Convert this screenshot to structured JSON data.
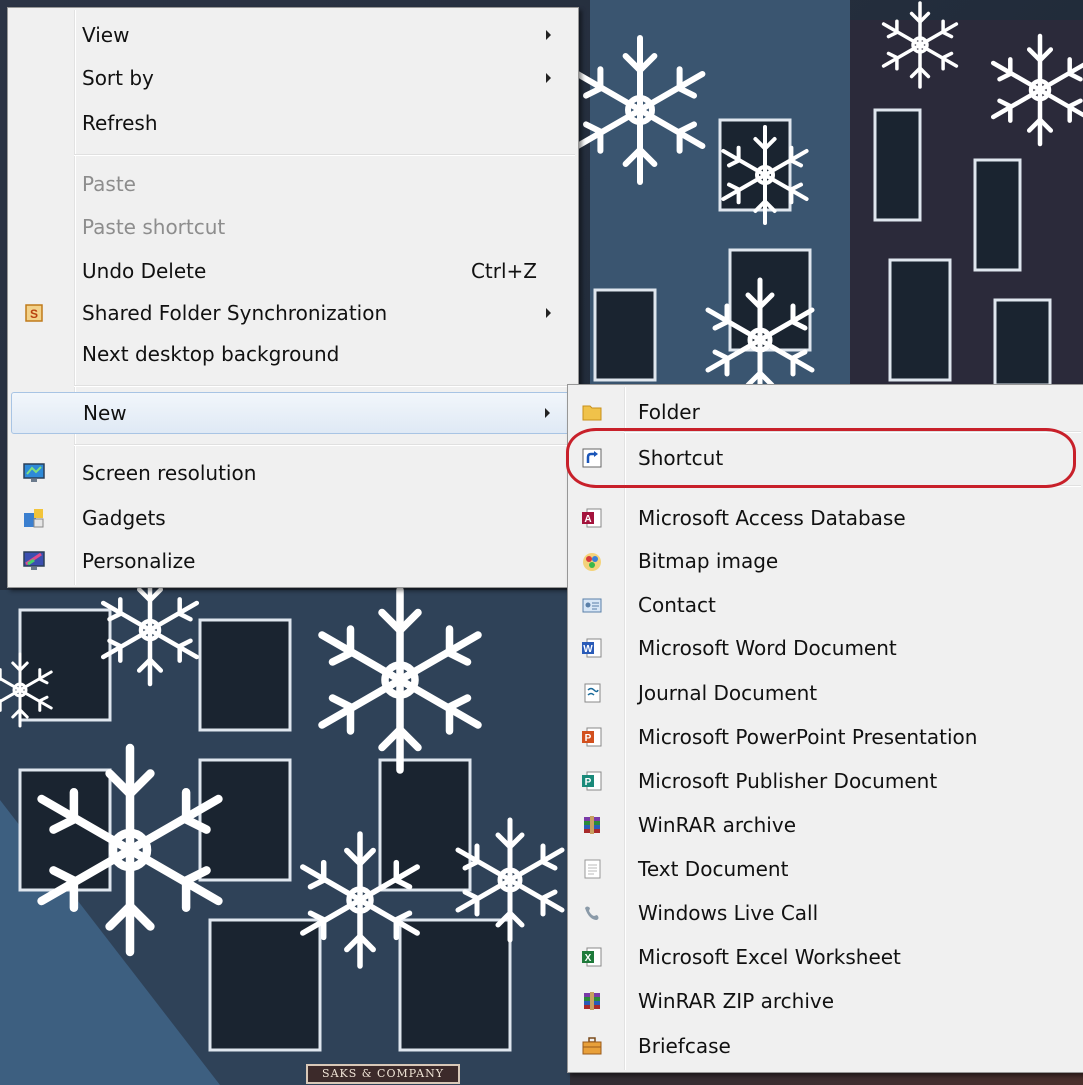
{
  "main_menu": {
    "view": "View",
    "sort_by": "Sort by",
    "refresh": "Refresh",
    "paste": "Paste",
    "paste_shortcut": "Paste shortcut",
    "undo_delete": "Undo Delete",
    "undo_delete_accel": "Ctrl+Z",
    "shared_folder_sync": "Shared Folder Synchronization",
    "next_background": "Next desktop background",
    "new": "New",
    "screen_resolution": "Screen resolution",
    "gadgets": "Gadgets",
    "personalize": "Personalize"
  },
  "new_menu": {
    "folder": "Folder",
    "shortcut": "Shortcut",
    "access_db": "Microsoft Access Database",
    "bitmap": "Bitmap image",
    "contact": "Contact",
    "word_doc": "Microsoft Word Document",
    "journal_doc": "Journal Document",
    "powerpoint": "Microsoft PowerPoint Presentation",
    "publisher": "Microsoft Publisher Document",
    "winrar": "WinRAR archive",
    "text_doc": "Text Document",
    "live_call": "Windows Live Call",
    "excel": "Microsoft Excel Worksheet",
    "winrar_zip": "WinRAR ZIP archive",
    "briefcase": "Briefcase"
  },
  "desktop": {
    "sign_text": "SAKS & COMPANY"
  },
  "colors": {
    "menu_bg": "#f0f0f0",
    "highlight_border": "#a8c4e4",
    "annotation": "#c8202a"
  }
}
